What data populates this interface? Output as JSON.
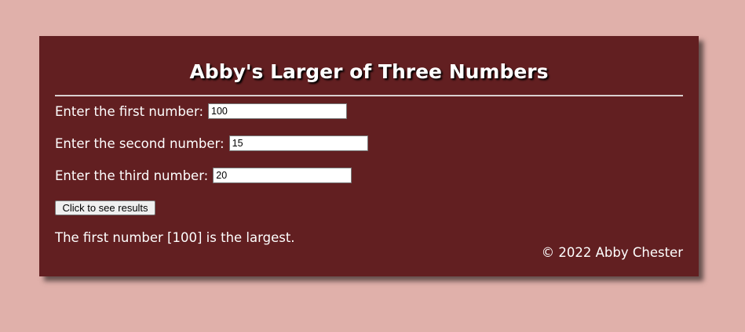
{
  "title": "Abby's Larger of Three Numbers",
  "fields": [
    {
      "label": "Enter the first number:",
      "value": "100"
    },
    {
      "label": "Enter the second number:",
      "value": "15"
    },
    {
      "label": "Enter the third number:",
      "value": "20"
    }
  ],
  "button_label": "Click to see results",
  "result": "The first number [100] is the largest.",
  "footer": "© 2022 Abby Chester",
  "colors": {
    "page_background": "#e0b0aa",
    "panel_background": "#621f21",
    "text": "#ffffff"
  }
}
